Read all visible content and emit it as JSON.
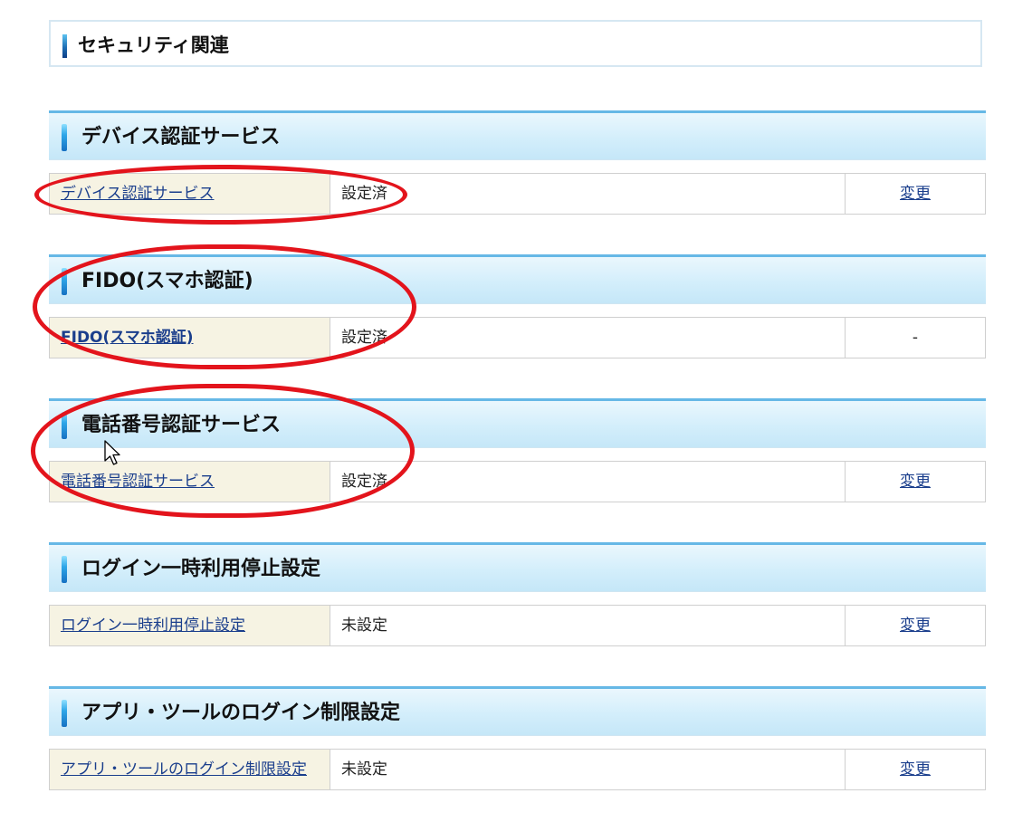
{
  "page_title": "セキュリティ関連",
  "sections": [
    {
      "header": "デバイス認証サービス",
      "link_label": "デバイス認証サービス",
      "status": "設定済",
      "action": "変更"
    },
    {
      "header": "FIDO(スマホ認証)",
      "link_label": "FIDO(スマホ認証)",
      "status": "設定済",
      "action": "-"
    },
    {
      "header": "電話番号認証サービス",
      "link_label": "電話番号認証サービス",
      "status": "設定済",
      "action": "変更"
    },
    {
      "header": "ログイン一時利用停止設定",
      "link_label": "ログイン一時利用停止設定",
      "status": "未設定",
      "action": "変更"
    },
    {
      "header": "アプリ・ツールのログイン制限設定",
      "link_label": "アプリ・ツールのログイン制限設定",
      "status": "未設定",
      "action": "変更"
    }
  ],
  "colors": {
    "accent_blue": "#66b8e6",
    "link": "#1a3e8c",
    "label_bg": "#f6f3e3",
    "annotation_red": "#e3141c"
  }
}
